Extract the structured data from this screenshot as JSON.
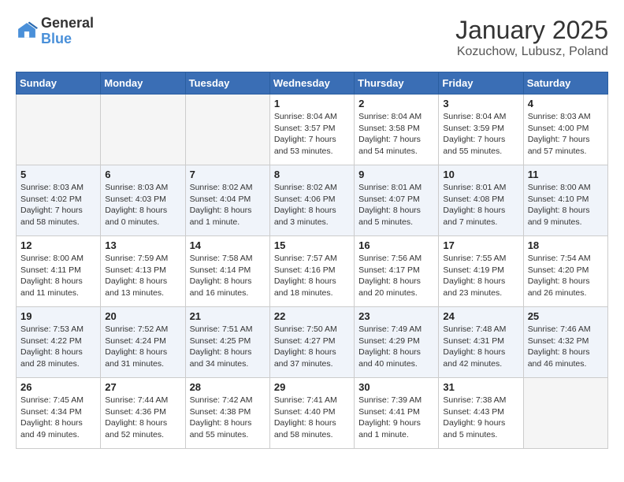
{
  "logo": {
    "line1": "General",
    "line2": "Blue"
  },
  "title": "January 2025",
  "subtitle": "Kozuchow, Lubusz, Poland",
  "weekdays": [
    "Sunday",
    "Monday",
    "Tuesday",
    "Wednesday",
    "Thursday",
    "Friday",
    "Saturday"
  ],
  "weeks": [
    [
      {
        "day": "",
        "empty": true
      },
      {
        "day": "",
        "empty": true
      },
      {
        "day": "",
        "empty": true
      },
      {
        "day": "1",
        "info": "Sunrise: 8:04 AM\nSunset: 3:57 PM\nDaylight: 7 hours and 53 minutes."
      },
      {
        "day": "2",
        "info": "Sunrise: 8:04 AM\nSunset: 3:58 PM\nDaylight: 7 hours and 54 minutes."
      },
      {
        "day": "3",
        "info": "Sunrise: 8:04 AM\nSunset: 3:59 PM\nDaylight: 7 hours and 55 minutes."
      },
      {
        "day": "4",
        "info": "Sunrise: 8:03 AM\nSunset: 4:00 PM\nDaylight: 7 hours and 57 minutes."
      }
    ],
    [
      {
        "day": "5",
        "info": "Sunrise: 8:03 AM\nSunset: 4:02 PM\nDaylight: 7 hours and 58 minutes."
      },
      {
        "day": "6",
        "info": "Sunrise: 8:03 AM\nSunset: 4:03 PM\nDaylight: 8 hours and 0 minutes."
      },
      {
        "day": "7",
        "info": "Sunrise: 8:02 AM\nSunset: 4:04 PM\nDaylight: 8 hours and 1 minute."
      },
      {
        "day": "8",
        "info": "Sunrise: 8:02 AM\nSunset: 4:06 PM\nDaylight: 8 hours and 3 minutes."
      },
      {
        "day": "9",
        "info": "Sunrise: 8:01 AM\nSunset: 4:07 PM\nDaylight: 8 hours and 5 minutes."
      },
      {
        "day": "10",
        "info": "Sunrise: 8:01 AM\nSunset: 4:08 PM\nDaylight: 8 hours and 7 minutes."
      },
      {
        "day": "11",
        "info": "Sunrise: 8:00 AM\nSunset: 4:10 PM\nDaylight: 8 hours and 9 minutes."
      }
    ],
    [
      {
        "day": "12",
        "info": "Sunrise: 8:00 AM\nSunset: 4:11 PM\nDaylight: 8 hours and 11 minutes."
      },
      {
        "day": "13",
        "info": "Sunrise: 7:59 AM\nSunset: 4:13 PM\nDaylight: 8 hours and 13 minutes."
      },
      {
        "day": "14",
        "info": "Sunrise: 7:58 AM\nSunset: 4:14 PM\nDaylight: 8 hours and 16 minutes."
      },
      {
        "day": "15",
        "info": "Sunrise: 7:57 AM\nSunset: 4:16 PM\nDaylight: 8 hours and 18 minutes."
      },
      {
        "day": "16",
        "info": "Sunrise: 7:56 AM\nSunset: 4:17 PM\nDaylight: 8 hours and 20 minutes."
      },
      {
        "day": "17",
        "info": "Sunrise: 7:55 AM\nSunset: 4:19 PM\nDaylight: 8 hours and 23 minutes."
      },
      {
        "day": "18",
        "info": "Sunrise: 7:54 AM\nSunset: 4:20 PM\nDaylight: 8 hours and 26 minutes."
      }
    ],
    [
      {
        "day": "19",
        "info": "Sunrise: 7:53 AM\nSunset: 4:22 PM\nDaylight: 8 hours and 28 minutes."
      },
      {
        "day": "20",
        "info": "Sunrise: 7:52 AM\nSunset: 4:24 PM\nDaylight: 8 hours and 31 minutes."
      },
      {
        "day": "21",
        "info": "Sunrise: 7:51 AM\nSunset: 4:25 PM\nDaylight: 8 hours and 34 minutes."
      },
      {
        "day": "22",
        "info": "Sunrise: 7:50 AM\nSunset: 4:27 PM\nDaylight: 8 hours and 37 minutes."
      },
      {
        "day": "23",
        "info": "Sunrise: 7:49 AM\nSunset: 4:29 PM\nDaylight: 8 hours and 40 minutes."
      },
      {
        "day": "24",
        "info": "Sunrise: 7:48 AM\nSunset: 4:31 PM\nDaylight: 8 hours and 42 minutes."
      },
      {
        "day": "25",
        "info": "Sunrise: 7:46 AM\nSunset: 4:32 PM\nDaylight: 8 hours and 46 minutes."
      }
    ],
    [
      {
        "day": "26",
        "info": "Sunrise: 7:45 AM\nSunset: 4:34 PM\nDaylight: 8 hours and 49 minutes."
      },
      {
        "day": "27",
        "info": "Sunrise: 7:44 AM\nSunset: 4:36 PM\nDaylight: 8 hours and 52 minutes."
      },
      {
        "day": "28",
        "info": "Sunrise: 7:42 AM\nSunset: 4:38 PM\nDaylight: 8 hours and 55 minutes."
      },
      {
        "day": "29",
        "info": "Sunrise: 7:41 AM\nSunset: 4:40 PM\nDaylight: 8 hours and 58 minutes."
      },
      {
        "day": "30",
        "info": "Sunrise: 7:39 AM\nSunset: 4:41 PM\nDaylight: 9 hours and 1 minute."
      },
      {
        "day": "31",
        "info": "Sunrise: 7:38 AM\nSunset: 4:43 PM\nDaylight: 9 hours and 5 minutes."
      },
      {
        "day": "",
        "empty": true
      }
    ]
  ]
}
